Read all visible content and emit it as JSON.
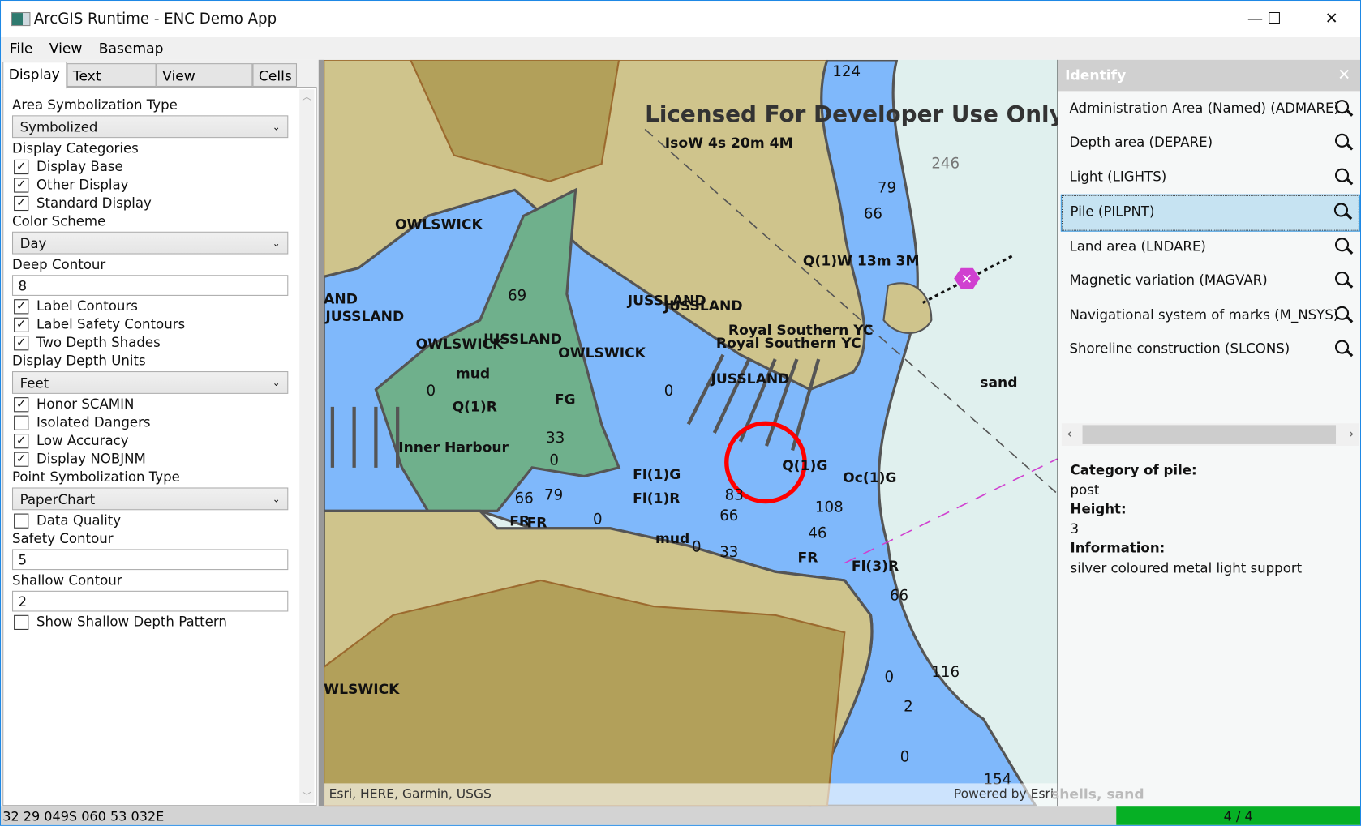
{
  "window": {
    "title": "ArcGIS Runtime - ENC Demo App",
    "minimize": "—",
    "maximize": "☐",
    "close": "✕"
  },
  "menu": [
    "File",
    "View",
    "Basemap"
  ],
  "tabs": [
    "Display",
    "Text Groups",
    "View Groups",
    "Cells"
  ],
  "display": {
    "area_symbolization_label": "Area Symbolization Type",
    "area_symbolization_value": "Symbolized",
    "display_categories_label": "Display Categories",
    "categories": [
      {
        "label": "Display Base",
        "checked": true
      },
      {
        "label": "Other Display",
        "checked": true
      },
      {
        "label": "Standard Display",
        "checked": true
      }
    ],
    "color_scheme_label": "Color Scheme",
    "color_scheme_value": "Day",
    "deep_contour_label": "Deep Contour",
    "deep_contour_value": "8",
    "contour_options": [
      {
        "label": "Label Contours",
        "checked": true
      },
      {
        "label": "Label Safety Contours",
        "checked": true
      },
      {
        "label": "Two Depth Shades",
        "checked": true
      }
    ],
    "depth_units_label": "Display Depth Units",
    "depth_units_value": "Feet",
    "other_options": [
      {
        "label": "Honor SCAMIN",
        "checked": true
      },
      {
        "label": "Isolated Dangers",
        "checked": false
      },
      {
        "label": "Low Accuracy",
        "checked": true
      },
      {
        "label": "Display NOBJNM",
        "checked": true
      }
    ],
    "point_symbolization_label": "Point Symbolization Type",
    "point_symbolization_value": "PaperChart",
    "data_quality": {
      "label": "Data Quality",
      "checked": false
    },
    "safety_contour_label": "Safety Contour",
    "safety_contour_value": "5",
    "shallow_contour_label": "Shallow Contour",
    "shallow_contour_value": "2",
    "shallow_pattern": {
      "label": "Show Shallow Depth Pattern",
      "checked": false
    }
  },
  "map": {
    "watermark": "Licensed For Developer Use Only",
    "labels": [
      "IsoW 4s 20m 4M",
      "OWLSWICK",
      "Q(1)W 13m 3M",
      "JUSSLAND",
      "JUSSLAND",
      "JUSSLAND",
      "OWLSWICK",
      "JUSSLAND",
      "OWLSWICK",
      "Royal Southern YC",
      "Royal Southern YC",
      "JUSSLAND",
      "mud",
      "Q(1)R",
      "FG",
      "Inner Harbour",
      "Fl(1)G",
      "Fl(1)R",
      "Q(1)G",
      "Oc(1)G",
      "FR",
      "FR",
      "mud",
      "FR",
      "Fl(3)R",
      "sand",
      "WLSWICK",
      "AND"
    ],
    "depths": [
      "124",
      "246",
      "79",
      "66",
      "0",
      "69",
      "33",
      "0",
      "66",
      "79",
      "0",
      "83",
      "66",
      "108",
      "46",
      "33",
      "0",
      "0",
      "116",
      "2",
      "0",
      "66",
      "154",
      "0"
    ],
    "attribution": "Esri, HERE, Garmin, USGS",
    "powered_by": "Powered by Esri",
    "colors": {
      "land": "#cfc48c",
      "land_dark": "#b2a05a",
      "water_shallow": "#7fb8fb",
      "water_green": "#6fb08c",
      "deep": "#e0f0ee",
      "highlight": "#ff0000"
    }
  },
  "identify": {
    "title": "Identify",
    "close": "✕",
    "items": [
      "Administration Area (Named) (ADMARE)",
      "Depth area (DEPARE)",
      "Light (LIGHTS)",
      "Pile (PILPNT)",
      "Land area (LNDARE)",
      "Magnetic variation (MAGVAR)",
      "Navigational system of marks (M_NSYS)",
      "Shoreline construction (SLCONS)"
    ],
    "selected_index": 3,
    "details": [
      {
        "key": "Category of pile:",
        "value": "post"
      },
      {
        "key": "Height:",
        "value": "3"
      },
      {
        "key": "Information:",
        "value": "silver coloured metal light support"
      }
    ],
    "background_text": "shells, sand"
  },
  "status": {
    "coordinates": "32 29 049S 060 53 032E",
    "progress_text": "4 / 4",
    "progress": 1.0
  }
}
